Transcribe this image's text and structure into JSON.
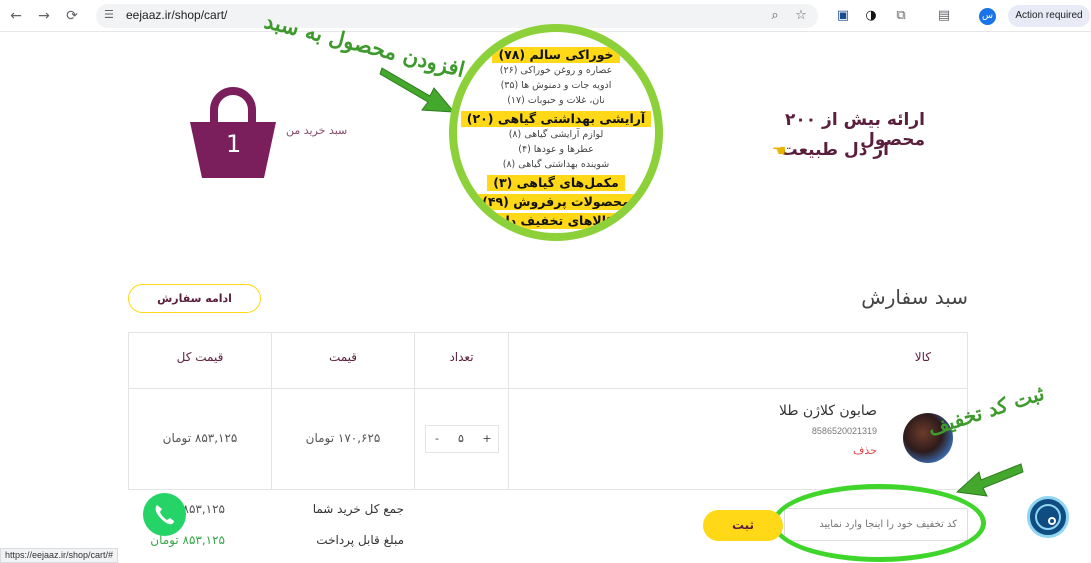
{
  "browser": {
    "url": "eejaaz.ir/shop/cart/",
    "profile_initial": "س",
    "action_required": "Action required",
    "icons": [
      "back-icon",
      "forward-icon",
      "reload-icon",
      "site-settings-icon",
      "zoom-icon",
      "bookmark-star-icon",
      "save-icon",
      "extension-icon",
      "puzzle-icon",
      "sidebar-icon"
    ]
  },
  "header": {
    "cart_count": "1",
    "cart_label": "سبد خرید من",
    "promo_line1": "ارائه بیش از ۲۰۰ محصول",
    "promo_line2": "از دل طبیعت",
    "promo_icon": "pointing-hand-icon"
  },
  "menu": {
    "items": [
      {
        "label": "خوراکی سالم (۷۸)",
        "main": true
      },
      {
        "label": "عصاره و روغن خوراکی (۲۶)",
        "main": false
      },
      {
        "label": "ادویه جات و دمنوش ها (۳۵)",
        "main": false
      },
      {
        "label": "نان، غلات و حبوبات (۱۷)",
        "main": false
      },
      {
        "label": "آرایشی بهداشتی گیاهی (۲۰)",
        "main": true
      },
      {
        "label": "لوازم آرایشی گیاهی (۸)",
        "main": false
      },
      {
        "label": "عطرها و عودها (۴)",
        "main": false
      },
      {
        "label": "شوینده بهداشتی گیاهی (۸)",
        "main": false
      },
      {
        "label": "مکمل‌های گیاهی (۳)",
        "main": true
      },
      {
        "label": "محصولات پرفروش (۴۹)",
        "main": true
      },
      {
        "label": "کالاهای تخفیف دار",
        "main": true
      }
    ]
  },
  "annotations": {
    "add_product": "افزودن محصول به سبد",
    "register_discount": "ثبت کد تخفیف"
  },
  "cart": {
    "title": "سبد سفارش",
    "continue_label": "ادامه سفارش",
    "headers": {
      "product": "کالا",
      "qty": "تعداد",
      "price": "قیمت",
      "total": "قیمت کل"
    },
    "item": {
      "name": "صابون کلاژن طلا",
      "sku": "8586520021319",
      "remove": "حذف",
      "qty": "۵",
      "minus": "-",
      "plus": "+",
      "price": "۱۷۰,۶۲۵ تومان",
      "total": "۸۵۳,۱۲۵ تومان"
    },
    "totals": {
      "sum_label": "جمع کل خرید شما",
      "sum_value": "۸۵۳,۱۲۵",
      "payable_label": "مبلغ قابل پرداخت",
      "payable_value": "۸۵۳,۱۲۵ تومان"
    },
    "coupon_placeholder": "کد تخفیف خود را اینجا وارد نمایید",
    "submit_label": "ثبت"
  },
  "status_url": "https://eejaaz.ir/shop/cart/#",
  "colors": {
    "accent_yellow": "#ffd817",
    "brand_purple": "#7a1f5c",
    "annot_green": "#3fd52a",
    "whatsapp": "#25d366"
  }
}
